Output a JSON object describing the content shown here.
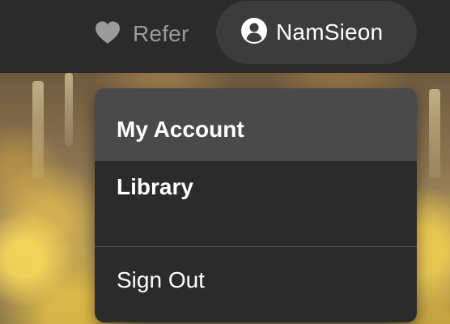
{
  "header": {
    "refer": {
      "label": "Refer",
      "icon": "heart-icon"
    },
    "user": {
      "name": "NamSieon",
      "icon": "user-circle-icon"
    }
  },
  "account_menu": {
    "items": [
      {
        "label": "My Account",
        "weight": "bold",
        "highlighted": true
      },
      {
        "label": "Library",
        "weight": "bold",
        "highlighted": false
      },
      {
        "label": "Sign Out",
        "weight": "normal",
        "highlighted": false
      }
    ]
  },
  "colors": {
    "header_bg": "#2b2b2b",
    "pill_bg": "#3c3c3c",
    "menu_bg": "#2b2b2b",
    "menu_highlight": "#4a4a4a",
    "refer_text": "#9b9b9b",
    "text": "#ffffff"
  }
}
